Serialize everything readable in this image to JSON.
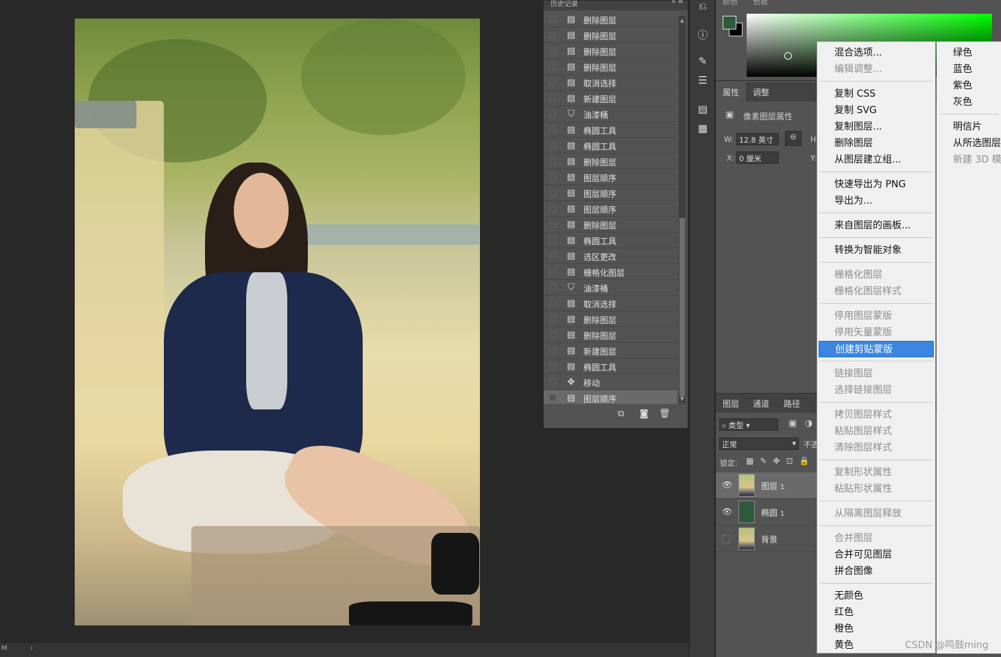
{
  "history_panel": {
    "title": "历史记录",
    "menu_glyphs": "» ≡",
    "items": [
      {
        "label": "删除图层",
        "icon": "document-icon"
      },
      {
        "label": "删除图层",
        "icon": "document-icon"
      },
      {
        "label": "删除图层",
        "icon": "document-icon"
      },
      {
        "label": "删除图层",
        "icon": "document-icon"
      },
      {
        "label": "取消选择",
        "icon": "document-icon"
      },
      {
        "label": "新建图层",
        "icon": "document-icon"
      },
      {
        "label": "油漆桶",
        "icon": "paint-bucket-icon"
      },
      {
        "label": "椭圆工具",
        "icon": "document-icon"
      },
      {
        "label": "椭圆工具",
        "icon": "document-icon"
      },
      {
        "label": "删除图层",
        "icon": "document-icon"
      },
      {
        "label": "图层顺序",
        "icon": "document-icon"
      },
      {
        "label": "图层顺序",
        "icon": "document-icon"
      },
      {
        "label": "图层顺序",
        "icon": "document-icon"
      },
      {
        "label": "删除图层",
        "icon": "document-icon"
      },
      {
        "label": "椭圆工具",
        "icon": "document-icon"
      },
      {
        "label": "选区更改",
        "icon": "document-icon"
      },
      {
        "label": "栅格化图层",
        "icon": "document-icon"
      },
      {
        "label": "油漆桶",
        "icon": "paint-bucket-icon"
      },
      {
        "label": "取消选择",
        "icon": "document-icon"
      },
      {
        "label": "删除图层",
        "icon": "document-icon"
      },
      {
        "label": "删除图层",
        "icon": "document-icon"
      },
      {
        "label": "新建图层",
        "icon": "document-icon"
      },
      {
        "label": "椭圆工具",
        "icon": "document-icon"
      },
      {
        "label": "移动",
        "icon": "move-icon"
      },
      {
        "label": "图层顺序",
        "icon": "document-icon",
        "selected": true
      }
    ]
  },
  "color_panel": {
    "tab1": "颜色",
    "tab2": "色板",
    "fg_color": "#2f5a40",
    "bg_color": "#000000"
  },
  "properties": {
    "tab_active": "属性",
    "tab_other": "调整",
    "type_label": "像素图层属性",
    "w_label": "W:",
    "w_value": "12.8 英寸",
    "h_label": "H",
    "x_label": "X:",
    "x_value": "0 厘米",
    "y_label": "Y:"
  },
  "layers_panel": {
    "tabs": [
      "图层",
      "通道",
      "路径"
    ],
    "filter_label": "类型",
    "blend_mode": "正常",
    "opacity_label": "不透",
    "lock_label": "锁定:",
    "layers": [
      {
        "name": "图层",
        "suffix": "1",
        "visible": true
      },
      {
        "name": "椭圆",
        "suffix": "1",
        "visible": true
      },
      {
        "name": "背景",
        "suffix": "",
        "visible": false
      }
    ]
  },
  "context_menu": {
    "items": [
      {
        "label": "混合选项...",
        "disabled": false
      },
      {
        "label": "编辑调整...",
        "disabled": true
      },
      {
        "sep": true
      },
      {
        "label": "复制 CSS",
        "disabled": false
      },
      {
        "label": "复制 SVG",
        "disabled": false
      },
      {
        "label": "复制图层...",
        "disabled": false
      },
      {
        "label": "删除图层",
        "disabled": false
      },
      {
        "label": "从图层建立组...",
        "disabled": false
      },
      {
        "sep": true
      },
      {
        "label": "快速导出为 PNG",
        "disabled": false
      },
      {
        "label": "导出为...",
        "disabled": false
      },
      {
        "sep": true
      },
      {
        "label": "来自图层的画板...",
        "disabled": false
      },
      {
        "sep": true
      },
      {
        "label": "转换为智能对象",
        "disabled": false
      },
      {
        "sep": true
      },
      {
        "label": "栅格化图层",
        "disabled": true
      },
      {
        "label": "栅格化图层样式",
        "disabled": true
      },
      {
        "sep": true
      },
      {
        "label": "停用图层蒙版",
        "disabled": true
      },
      {
        "label": "停用矢量蒙版",
        "disabled": true
      },
      {
        "label": "创建剪贴蒙版",
        "disabled": false,
        "highlighted": true
      },
      {
        "sep": true
      },
      {
        "label": "链接图层",
        "disabled": true
      },
      {
        "label": "选择链接图层",
        "disabled": true
      },
      {
        "sep": true
      },
      {
        "label": "拷贝图层样式",
        "disabled": true
      },
      {
        "label": "粘贴图层样式",
        "disabled": true
      },
      {
        "label": "清除图层样式",
        "disabled": true
      },
      {
        "sep": true
      },
      {
        "label": "复制形状属性",
        "disabled": true
      },
      {
        "label": "粘贴形状属性",
        "disabled": true
      },
      {
        "sep": true
      },
      {
        "label": "从隔离图层释放",
        "disabled": true
      },
      {
        "sep": true
      },
      {
        "label": "合并图层",
        "disabled": true
      },
      {
        "label": "合并可见图层",
        "disabled": false
      },
      {
        "label": "拼合图像",
        "disabled": false
      },
      {
        "sep": true
      },
      {
        "label": "无颜色",
        "disabled": false
      },
      {
        "label": "红色",
        "disabled": false
      },
      {
        "label": "橙色",
        "disabled": false
      },
      {
        "label": "黄色",
        "disabled": false
      }
    ],
    "column2": [
      {
        "label": "绿色",
        "disabled": false
      },
      {
        "label": "蓝色",
        "disabled": false
      },
      {
        "label": "紫色",
        "disabled": false
      },
      {
        "label": "灰色",
        "disabled": false
      },
      {
        "sep": true
      },
      {
        "label": "明信片",
        "disabled": false
      },
      {
        "label": "从所选图层",
        "disabled": false
      },
      {
        "label": "新建 3D 模",
        "disabled": true
      }
    ]
  },
  "status": {
    "left": "M",
    "arrow": "›"
  },
  "watermark": "CSDN @鸣鼓ming"
}
